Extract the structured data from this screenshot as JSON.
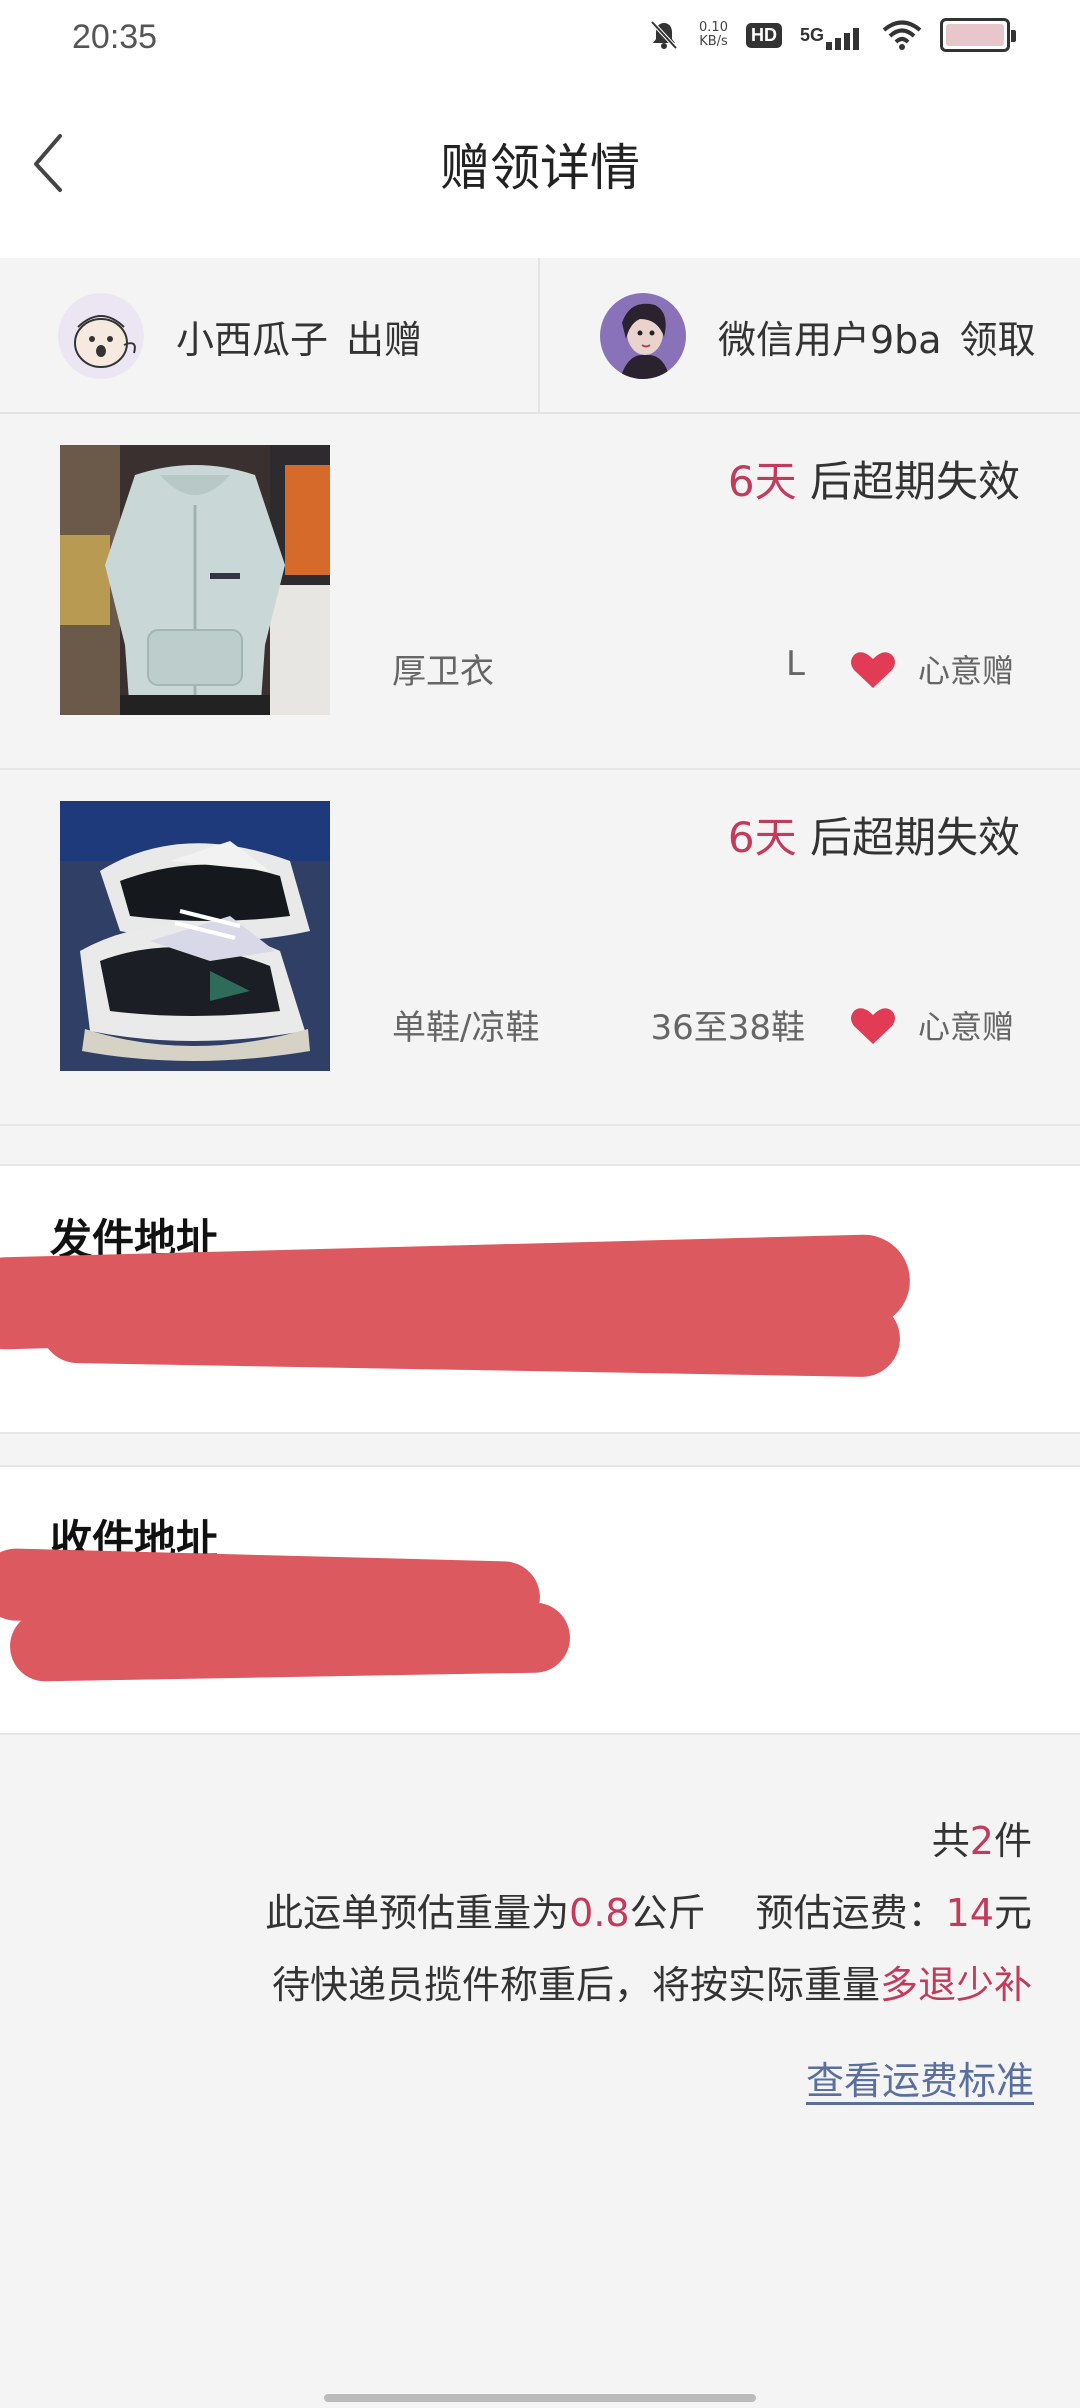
{
  "status_bar": {
    "time": "20:35",
    "net_speed_value": "0.10",
    "net_speed_unit": "KB/s",
    "hd": "HD",
    "network": "5G",
    "icons": [
      "mute-icon",
      "net-speed-icon",
      "hd-icon",
      "signal-icon",
      "wifi-icon",
      "battery-icon"
    ]
  },
  "header": {
    "title": "赠领详情"
  },
  "parties": {
    "giver": {
      "name": "小西瓜子",
      "action": "出赠"
    },
    "receiver": {
      "name": "微信用户9ba",
      "action": "领取"
    }
  },
  "items": [
    {
      "expire_days": "6天",
      "expire_text": "后超期失效",
      "category": "厚卫衣",
      "size": "L",
      "gift_type": "心意赠"
    },
    {
      "expire_days": "6天",
      "expire_text": "后超期失效",
      "category": "单鞋/凉鞋",
      "size": "36至38鞋",
      "gift_type": "心意赠"
    }
  ],
  "send_address": {
    "title": "发件地址"
  },
  "receive_address": {
    "title": "收件地址"
  },
  "summary": {
    "count_prefix": "共",
    "count": "2",
    "count_suffix": "件",
    "weight_prefix": "此运单预估重量为",
    "weight": "0.8",
    "weight_unit": "公斤",
    "fee_label": "预估运费：",
    "fee": "14",
    "fee_unit": "元",
    "note_prefix": "待快递员揽件称重后，将按实际重量",
    "note_highlight": "多退少补",
    "link": "查看运费标准"
  },
  "colors": {
    "accent": "#c43a5a",
    "heart": "#e23b55",
    "redaction": "#dc5a5f",
    "link": "#5a6f9e"
  }
}
